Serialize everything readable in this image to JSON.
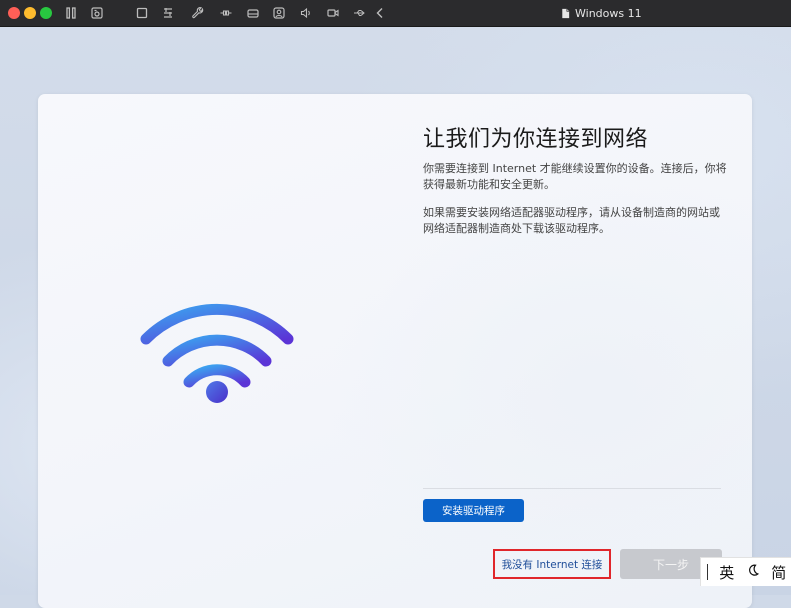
{
  "window": {
    "title": "Windows 11"
  },
  "toolbar_icons": [
    "pause-icon",
    "screenshot-icon",
    "window-icon",
    "keyboard-icon",
    "wrench-icon",
    "connect-icon",
    "drive-icon",
    "camera-icon",
    "audio-icon",
    "video-icon",
    "usb-icon",
    "back-icon"
  ],
  "oobe": {
    "heading": "让我们为你连接到网络",
    "paragraph1": "你需要连接到 Internet 才能继续设置你的设备。连接后，你将获得最新功能和安全更新。",
    "paragraph2": "如果需要安装网络适配器驱动程序，请从设备制造商的网站或网络适配器制造商处下载该驱动程序。",
    "install_driver_label": "安装驱动程序",
    "no_internet_label": "我没有 Internet 连接",
    "next_label": "下一步",
    "next_enabled": false
  },
  "ime": {
    "lang": "英",
    "mode": "简",
    "moon_icon": "moon-icon"
  },
  "colors": {
    "accent": "#0b63c9",
    "highlight_border": "#e0262b",
    "link_text": "#1f4e99",
    "disabled_button": "#c7c9ce",
    "wifi_gradient_start": "#3ba3f0",
    "wifi_gradient_end": "#5b34d6"
  }
}
